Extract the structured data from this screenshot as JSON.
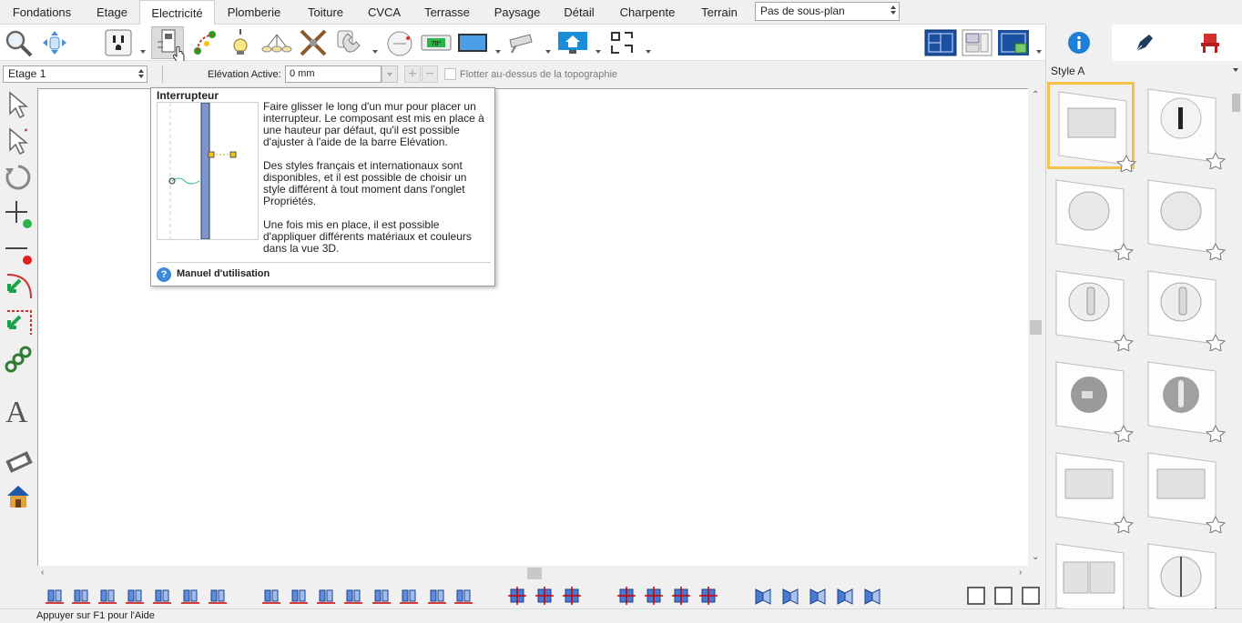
{
  "tabs": [
    {
      "label": "Fondations",
      "active": false
    },
    {
      "label": "Etage",
      "active": false
    },
    {
      "label": "Electricité",
      "active": true
    },
    {
      "label": "Plomberie",
      "active": false
    },
    {
      "label": "Toiture",
      "active": false
    },
    {
      "label": "CVCA",
      "active": false
    },
    {
      "label": "Terrasse",
      "active": false
    },
    {
      "label": "Paysage",
      "active": false
    },
    {
      "label": "Détail",
      "active": false
    },
    {
      "label": "Charpente",
      "active": false
    },
    {
      "label": "Terrain",
      "active": false
    }
  ],
  "subplan_select": "Pas de sous-plan",
  "floor_select": "Etage 1",
  "elevation": {
    "label": "Elévation Active:",
    "value": "0 mm"
  },
  "float_option": "Flotter au-dessus de la topographie",
  "right_panel": {
    "tabs": [
      "info-icon",
      "pen-icon",
      "chair-icon"
    ],
    "style_select": "Style A"
  },
  "tooltip": {
    "title": "Interrupteur",
    "paragraphs": [
      "Faire glisser le long d'un mur pour placer un interrupteur. Le composant est mis en place à une hauteur par défaut, qu'il est possible d'ajuster à l'aide de la barre Elévation.",
      "Des styles français et internationaux sont disponibles, et il est possible de choisir un style différent à tout moment dans l'onglet Propriétés.",
      "Une fois mis en place, il est possible d'appliquer différents matériaux et couleurs dans la vue 3D."
    ],
    "help_link": "Manuel d'utilisation"
  },
  "status_text": "Appuyer sur F1 pour l'Aide",
  "colors": {
    "accent": "#3d8ad8",
    "selection": "#f3c34a",
    "wall": "#7f96c8"
  }
}
